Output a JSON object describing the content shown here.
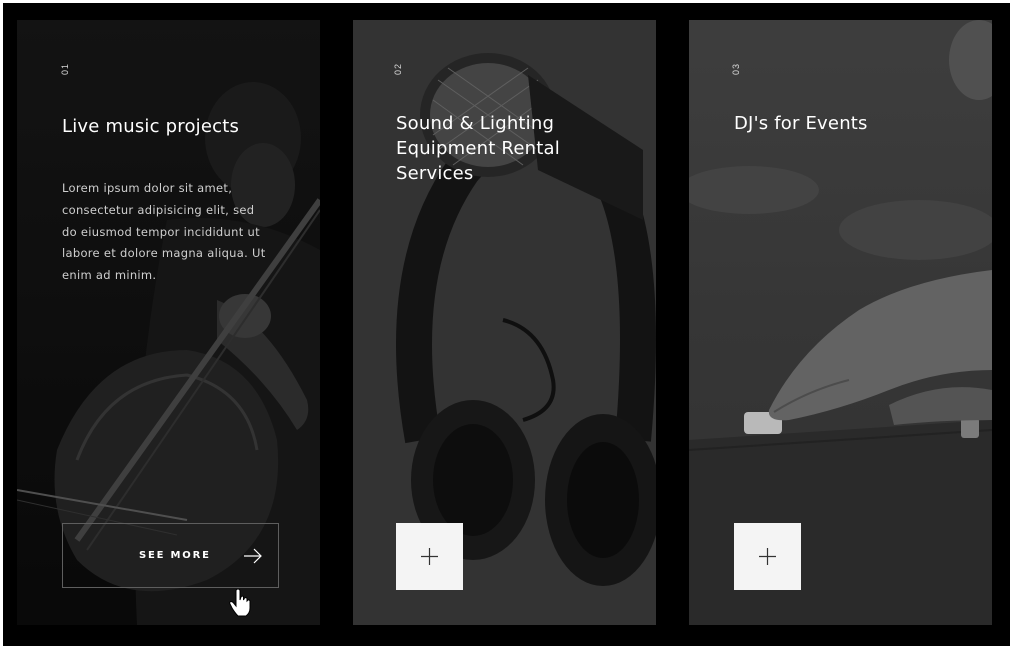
{
  "cards": [
    {
      "number": "01",
      "title": "Live music projects",
      "description": "Lorem ipsum dolor sit amet, consectetur adipisicing elit, sed do eiusmod tempor incididunt ut labore et dolore magna aliqua. Ut enim ad minim.",
      "button_label": "SEE MORE",
      "image": "cellist-photo"
    },
    {
      "number": "02",
      "title": "Sound & Lighting Equipment Rental Services",
      "image": "microphone-headphones-photo"
    },
    {
      "number": "03",
      "title": "DJ's for Events",
      "image": "dj-mixer-photo"
    }
  ],
  "icons": {
    "see_more_arrow": "arrow-right-icon",
    "expand": "plus-icon",
    "pointer": "hand-cursor-icon"
  },
  "colors": {
    "frame": "#000000",
    "title_text": "#ffffff",
    "body_text": "#cfcfcf",
    "plus_button_bg": "#f4f4f4",
    "button_border": "#5e5e5e"
  }
}
